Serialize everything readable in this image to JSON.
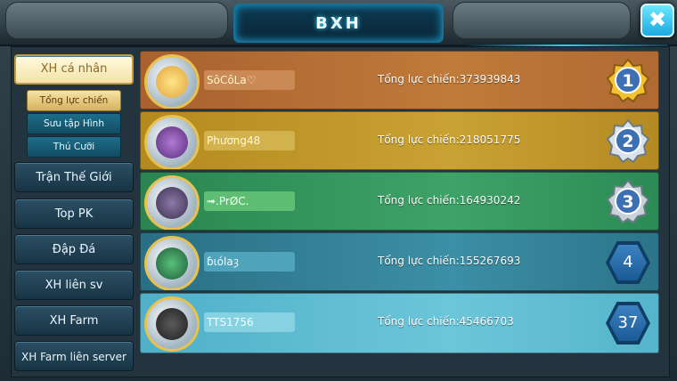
{
  "header": {
    "title": "BXH",
    "close_label": "✖"
  },
  "sidebar": {
    "main_active": "XH cá nhân",
    "sub_items": [
      "Tổng lực chiến",
      "Sưu tập Hình",
      "Thú Cưỡi"
    ],
    "items": [
      "Trận Thế Giới",
      "Top PK",
      "Đập Đá",
      "XH liên sv",
      "XH Farm",
      "XH Farm liên server"
    ]
  },
  "ranking": [
    {
      "rank": "1",
      "name": "SôCôLa♡",
      "power": "Tổng lực chiến:373939843",
      "badge": "gold-medal"
    },
    {
      "rank": "2",
      "name": "Phương48",
      "power": "Tổng lực chiến:218051775",
      "badge": "silver-medal"
    },
    {
      "rank": "3",
      "name": "➟.PrØC.",
      "power": "Tổng lực chiến:164930242",
      "badge": "silver-medal"
    },
    {
      "rank": "4",
      "name": "ɓιólaȝ",
      "power": "Tổng lực chiến:155267693",
      "badge": "hex"
    },
    {
      "rank": "37",
      "name": "TTS1756",
      "power": "Tổng lực chiến:45466703",
      "badge": "hex"
    }
  ],
  "colors": {
    "row1": "#b86a2e",
    "row2": "#b98a22",
    "row3": "#2e8d55",
    "row4": "#2f7a8c",
    "row5": "#5cb8cf"
  }
}
